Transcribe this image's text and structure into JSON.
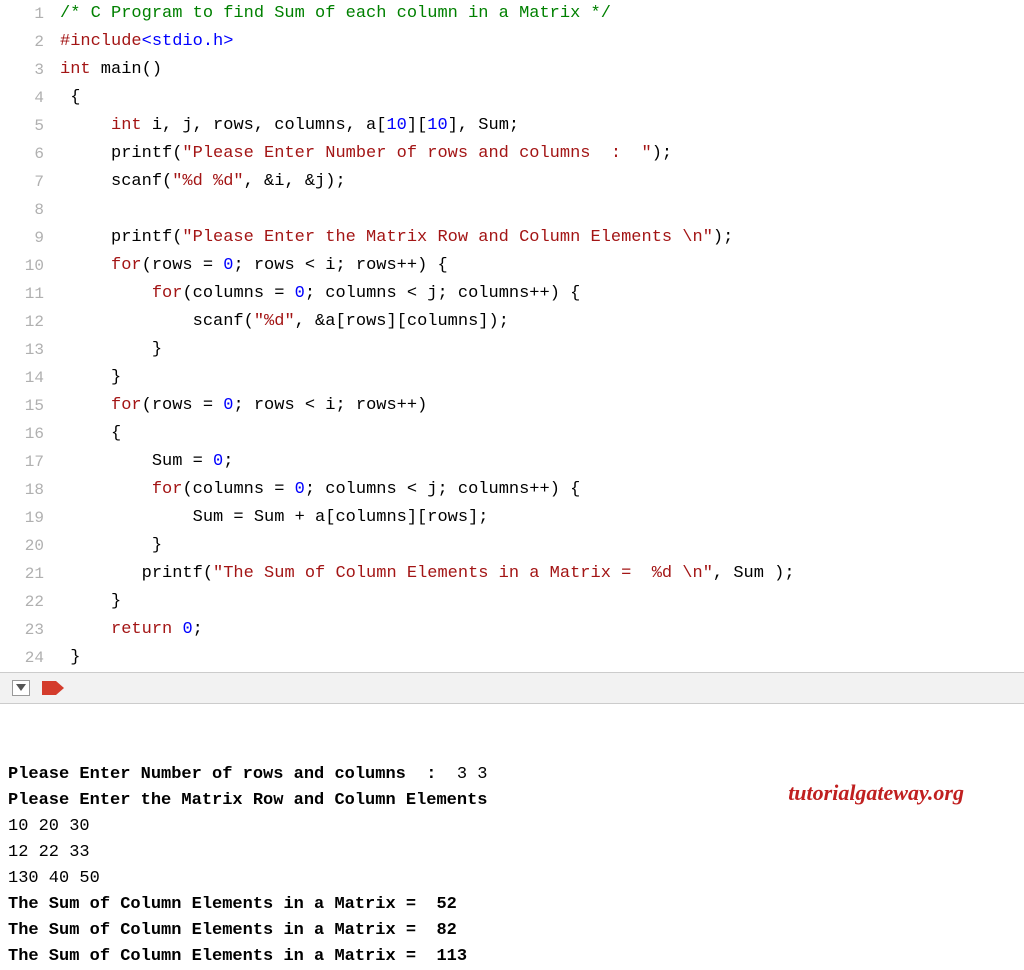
{
  "code": {
    "lines": [
      {
        "n": 1,
        "segments": [
          {
            "cls": "c-comment",
            "t": "/* C Program to find Sum of each column in a Matrix */"
          }
        ]
      },
      {
        "n": 2,
        "segments": [
          {
            "cls": "c-include",
            "t": "#include"
          },
          {
            "cls": "c-includefile",
            "t": "<stdio.h>"
          }
        ]
      },
      {
        "n": 3,
        "segments": [
          {
            "cls": "c-keyword",
            "t": "int"
          },
          {
            "cls": "c-plain",
            "t": " main()"
          }
        ]
      },
      {
        "n": 4,
        "segments": [
          {
            "cls": "c-plain",
            "t": " {"
          }
        ]
      },
      {
        "n": 5,
        "segments": [
          {
            "cls": "c-plain",
            "t": "     "
          },
          {
            "cls": "c-keyword",
            "t": "int"
          },
          {
            "cls": "c-plain",
            "t": " i, j, rows, columns, a["
          },
          {
            "cls": "c-number",
            "t": "10"
          },
          {
            "cls": "c-plain",
            "t": "]["
          },
          {
            "cls": "c-number",
            "t": "10"
          },
          {
            "cls": "c-plain",
            "t": "], Sum;"
          }
        ]
      },
      {
        "n": 6,
        "segments": [
          {
            "cls": "c-plain",
            "t": "     printf("
          },
          {
            "cls": "c-string",
            "t": "\"Please Enter Number of rows and columns  :  \""
          },
          {
            "cls": "c-plain",
            "t": ");"
          }
        ]
      },
      {
        "n": 7,
        "segments": [
          {
            "cls": "c-plain",
            "t": "     scanf("
          },
          {
            "cls": "c-string",
            "t": "\"%d %d\""
          },
          {
            "cls": "c-plain",
            "t": ", &i, &j);"
          }
        ]
      },
      {
        "n": 8,
        "segments": [
          {
            "cls": "c-plain",
            "t": ""
          }
        ]
      },
      {
        "n": 9,
        "segments": [
          {
            "cls": "c-plain",
            "t": "     printf("
          },
          {
            "cls": "c-string",
            "t": "\"Please Enter the Matrix Row and Column Elements \\n\""
          },
          {
            "cls": "c-plain",
            "t": ");"
          }
        ]
      },
      {
        "n": 10,
        "segments": [
          {
            "cls": "c-plain",
            "t": "     "
          },
          {
            "cls": "c-keyword",
            "t": "for"
          },
          {
            "cls": "c-plain",
            "t": "(rows = "
          },
          {
            "cls": "c-number",
            "t": "0"
          },
          {
            "cls": "c-plain",
            "t": "; rows < i; rows++) {"
          }
        ]
      },
      {
        "n": 11,
        "segments": [
          {
            "cls": "c-plain",
            "t": "         "
          },
          {
            "cls": "c-keyword",
            "t": "for"
          },
          {
            "cls": "c-plain",
            "t": "(columns = "
          },
          {
            "cls": "c-number",
            "t": "0"
          },
          {
            "cls": "c-plain",
            "t": "; columns < j; columns++) {"
          }
        ]
      },
      {
        "n": 12,
        "segments": [
          {
            "cls": "c-plain",
            "t": "             scanf("
          },
          {
            "cls": "c-string",
            "t": "\"%d\""
          },
          {
            "cls": "c-plain",
            "t": ", &a[rows][columns]);"
          }
        ]
      },
      {
        "n": 13,
        "segments": [
          {
            "cls": "c-plain",
            "t": "         }"
          }
        ]
      },
      {
        "n": 14,
        "segments": [
          {
            "cls": "c-plain",
            "t": "     }"
          }
        ]
      },
      {
        "n": 15,
        "segments": [
          {
            "cls": "c-plain",
            "t": "     "
          },
          {
            "cls": "c-keyword",
            "t": "for"
          },
          {
            "cls": "c-plain",
            "t": "(rows = "
          },
          {
            "cls": "c-number",
            "t": "0"
          },
          {
            "cls": "c-plain",
            "t": "; rows < i; rows++)"
          }
        ]
      },
      {
        "n": 16,
        "segments": [
          {
            "cls": "c-plain",
            "t": "     {"
          }
        ]
      },
      {
        "n": 17,
        "segments": [
          {
            "cls": "c-plain",
            "t": "         Sum = "
          },
          {
            "cls": "c-number",
            "t": "0"
          },
          {
            "cls": "c-plain",
            "t": ";"
          }
        ]
      },
      {
        "n": 18,
        "segments": [
          {
            "cls": "c-plain",
            "t": "         "
          },
          {
            "cls": "c-keyword",
            "t": "for"
          },
          {
            "cls": "c-plain",
            "t": "(columns = "
          },
          {
            "cls": "c-number",
            "t": "0"
          },
          {
            "cls": "c-plain",
            "t": "; columns < j; columns++) {"
          }
        ]
      },
      {
        "n": 19,
        "segments": [
          {
            "cls": "c-plain",
            "t": "             Sum = Sum + a[columns][rows];"
          }
        ]
      },
      {
        "n": 20,
        "segments": [
          {
            "cls": "c-plain",
            "t": "         }"
          }
        ]
      },
      {
        "n": 21,
        "segments": [
          {
            "cls": "c-plain",
            "t": "        printf("
          },
          {
            "cls": "c-string",
            "t": "\"The Sum of Column Elements in a Matrix =  %d \\n\""
          },
          {
            "cls": "c-plain",
            "t": ", Sum );"
          }
        ]
      },
      {
        "n": 22,
        "segments": [
          {
            "cls": "c-plain",
            "t": "     }"
          }
        ]
      },
      {
        "n": 23,
        "segments": [
          {
            "cls": "c-plain",
            "t": "     "
          },
          {
            "cls": "c-keyword",
            "t": "return"
          },
          {
            "cls": "c-plain",
            "t": " "
          },
          {
            "cls": "c-number",
            "t": "0"
          },
          {
            "cls": "c-plain",
            "t": ";"
          }
        ]
      },
      {
        "n": 24,
        "segments": [
          {
            "cls": "c-plain",
            "t": " }"
          }
        ]
      }
    ]
  },
  "console": {
    "lines": [
      {
        "bold": true,
        "t": "Please Enter Number of rows and columns  :  ",
        "tail": "3 3"
      },
      {
        "bold": true,
        "t": "Please Enter the Matrix Row and Column Elements",
        "tail": ""
      },
      {
        "bold": false,
        "t": "10 20 30",
        "tail": ""
      },
      {
        "bold": false,
        "t": "12 22 33",
        "tail": ""
      },
      {
        "bold": false,
        "t": "130 40 50",
        "tail": ""
      },
      {
        "bold": true,
        "t": "The Sum of Column Elements in a Matrix =  52",
        "tail": ""
      },
      {
        "bold": true,
        "t": "The Sum of Column Elements in a Matrix =  82",
        "tail": ""
      },
      {
        "bold": true,
        "t": "The Sum of Column Elements in a Matrix =  113",
        "tail": ""
      }
    ]
  },
  "watermark": "tutorialgateway.org"
}
